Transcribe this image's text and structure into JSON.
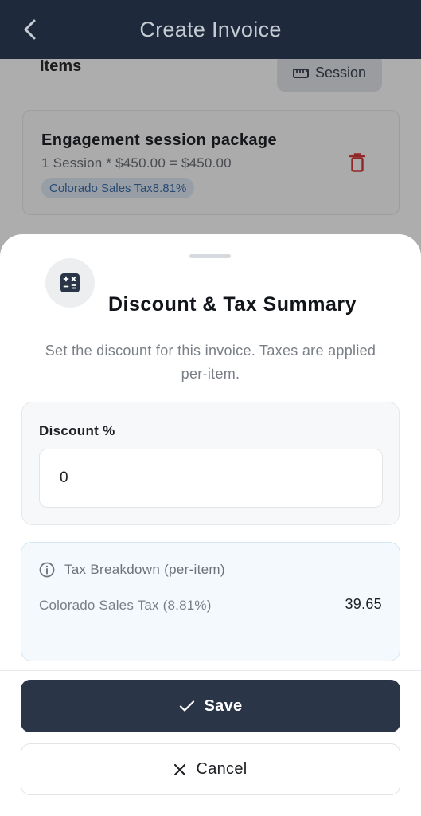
{
  "header": {
    "title": "Create Invoice"
  },
  "items_section": {
    "label": "Items",
    "session_button_label": "Session",
    "item": {
      "name": "Engagement session package",
      "calculation": "1 Session * $450.00 = $450.00",
      "tax_badge": "Colorado Sales Tax8.81%"
    }
  },
  "sheet": {
    "title": "Discount & Tax Summary",
    "description": "Set the discount for this invoice. Taxes are applied per-item.",
    "discount": {
      "label": "Discount %",
      "value": "0"
    },
    "tax_breakdown": {
      "heading": "Tax Breakdown (per-item)",
      "rows": [
        {
          "name": "Colorado Sales Tax (8.81%)",
          "amount": "39.65"
        }
      ]
    },
    "save_label": "Save",
    "cancel_label": "Cancel"
  },
  "colors": {
    "primary_dark": "#2a3648",
    "header_bg": "#1e2a3b",
    "danger": "#d93a3a",
    "info_bg": "#f3f9fd",
    "badge_text": "#3e6da8"
  }
}
